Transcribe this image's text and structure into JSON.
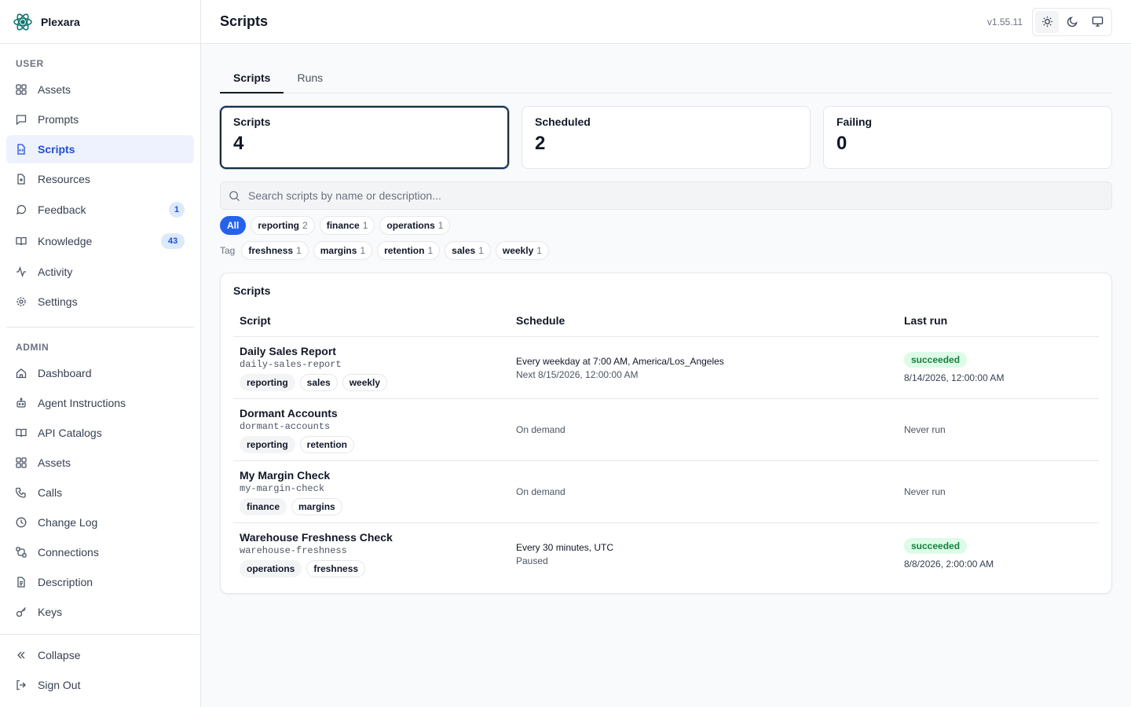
{
  "brand": {
    "name": "Plexara",
    "logo_icon": "atom-icon"
  },
  "sidebar": {
    "user_section": "USER",
    "user_items": [
      {
        "label": "Assets",
        "icon": "grid-icon",
        "active": false
      },
      {
        "label": "Prompts",
        "icon": "message-square-icon",
        "active": false
      },
      {
        "label": "Scripts",
        "icon": "file-code-icon",
        "active": true
      },
      {
        "label": "Resources",
        "icon": "file-plus-icon",
        "active": false
      },
      {
        "label": "Feedback",
        "icon": "message-circle-icon",
        "active": false,
        "badge": "1"
      },
      {
        "label": "Knowledge",
        "icon": "book-open-icon",
        "active": false,
        "badge": "43"
      },
      {
        "label": "Activity",
        "icon": "activity-icon",
        "active": false
      },
      {
        "label": "Settings",
        "icon": "gear-icon",
        "active": false
      }
    ],
    "admin_section": "ADMIN",
    "admin_items": [
      {
        "label": "Dashboard",
        "icon": "home-icon"
      },
      {
        "label": "Agent Instructions",
        "icon": "bot-icon"
      },
      {
        "label": "API Catalogs",
        "icon": "book-open-icon"
      },
      {
        "label": "Assets",
        "icon": "grid-icon"
      },
      {
        "label": "Calls",
        "icon": "phone-icon"
      },
      {
        "label": "Change Log",
        "icon": "clock-icon"
      },
      {
        "label": "Connections",
        "icon": "connections-icon"
      },
      {
        "label": "Description",
        "icon": "file-text-icon"
      },
      {
        "label": "Keys",
        "icon": "key-icon"
      }
    ],
    "footer": {
      "collapse": "Collapse",
      "sign_out": "Sign Out"
    }
  },
  "header": {
    "title": "Scripts",
    "version": "v1.55.11",
    "theme_buttons": [
      "sun-icon",
      "moon-icon",
      "monitor-icon"
    ]
  },
  "tabs": [
    {
      "label": "Scripts",
      "active": true
    },
    {
      "label": "Runs",
      "active": false
    }
  ],
  "stats": [
    {
      "label": "Scripts",
      "value": "4",
      "active": true
    },
    {
      "label": "Scheduled",
      "value": "2",
      "active": false
    },
    {
      "label": "Failing",
      "value": "0",
      "active": false
    }
  ],
  "search": {
    "placeholder": "Search scripts by name or description...",
    "value": ""
  },
  "filters": {
    "all_label": "All",
    "categories": [
      {
        "label": "reporting",
        "count": "2"
      },
      {
        "label": "finance",
        "count": "1"
      },
      {
        "label": "operations",
        "count": "1"
      }
    ],
    "tag_label": "Tag",
    "tags": [
      {
        "label": "freshness",
        "count": "1"
      },
      {
        "label": "margins",
        "count": "1"
      },
      {
        "label": "retention",
        "count": "1"
      },
      {
        "label": "sales",
        "count": "1"
      },
      {
        "label": "weekly",
        "count": "1"
      }
    ]
  },
  "table": {
    "title": "Scripts",
    "columns": [
      "Script",
      "Schedule",
      "Last run"
    ],
    "rows": [
      {
        "name": "Daily Sales Report",
        "slug": "daily-sales-report",
        "tags": [
          {
            "label": "reporting",
            "filled": true
          },
          {
            "label": "sales",
            "filled": false
          },
          {
            "label": "weekly",
            "filled": false
          }
        ],
        "schedule": "Every weekday at 7:00 AM, America/Los_Angeles",
        "schedule_sub": "Next 8/15/2026, 12:00:00 AM",
        "status": "succeeded",
        "last_run": "8/14/2026, 12:00:00 AM"
      },
      {
        "name": "Dormant Accounts",
        "slug": "dormant-accounts",
        "tags": [
          {
            "label": "reporting",
            "filled": true
          },
          {
            "label": "retention",
            "filled": false
          }
        ],
        "schedule": "On demand",
        "schedule_sub": "",
        "status": "",
        "last_run": "Never run"
      },
      {
        "name": "My Margin Check",
        "slug": "my-margin-check",
        "tags": [
          {
            "label": "finance",
            "filled": true
          },
          {
            "label": "margins",
            "filled": false
          }
        ],
        "schedule": "On demand",
        "schedule_sub": "",
        "status": "",
        "last_run": "Never run"
      },
      {
        "name": "Warehouse Freshness Check",
        "slug": "warehouse-freshness",
        "tags": [
          {
            "label": "operations",
            "filled": true
          },
          {
            "label": "freshness",
            "filled": false
          }
        ],
        "schedule": "Every 30 minutes, UTC",
        "schedule_sub": "Paused",
        "status": "succeeded",
        "last_run": "8/8/2026, 2:00:00 AM"
      }
    ]
  }
}
